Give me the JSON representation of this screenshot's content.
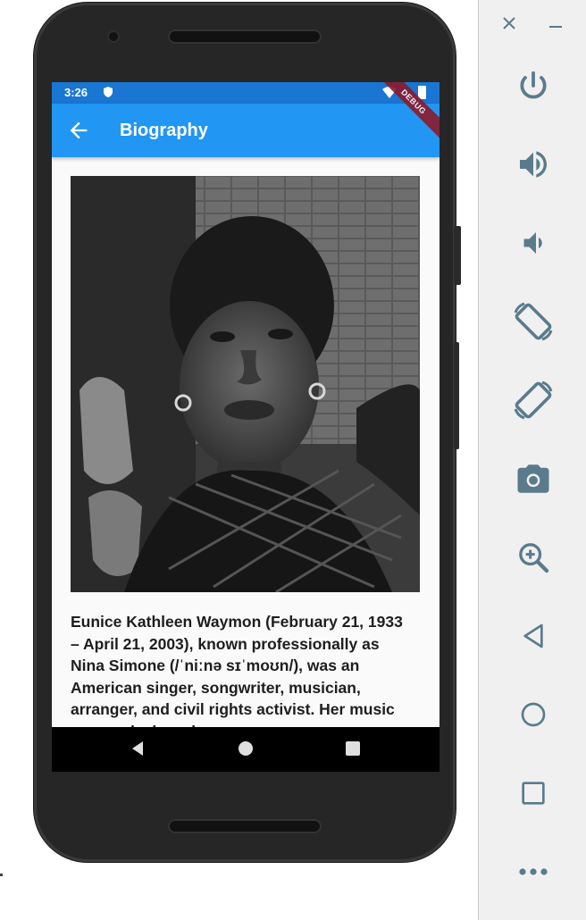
{
  "status_bar": {
    "time": "3:26"
  },
  "debug_banner": "DEBUG",
  "app_bar": {
    "title": "Biography"
  },
  "bio_text": "Eunice Kathleen Waymon (February 21, 1933 – April 21, 2003), known professionally as Nina Simone (/ˈniːnə sɪˈmoʊn/), was an American singer, songwriter, musician, arranger, and civil rights activist. Her music spanned a broad",
  "nav_bar": {
    "back": "back-triangle",
    "home": "home-circle",
    "recents": "recents-square"
  },
  "emulator_panel": {
    "window_controls": [
      "close",
      "minimize"
    ],
    "tools": [
      "power",
      "volume-up",
      "volume-down",
      "rotate-left",
      "rotate-right",
      "screenshot",
      "zoom",
      "back",
      "home",
      "overview",
      "more"
    ]
  },
  "colors": {
    "status_bar": "#1976d2",
    "app_bar": "#2196f3",
    "panel_icon": "#5a7b8c",
    "debug_banner": "#8b1a2b"
  }
}
